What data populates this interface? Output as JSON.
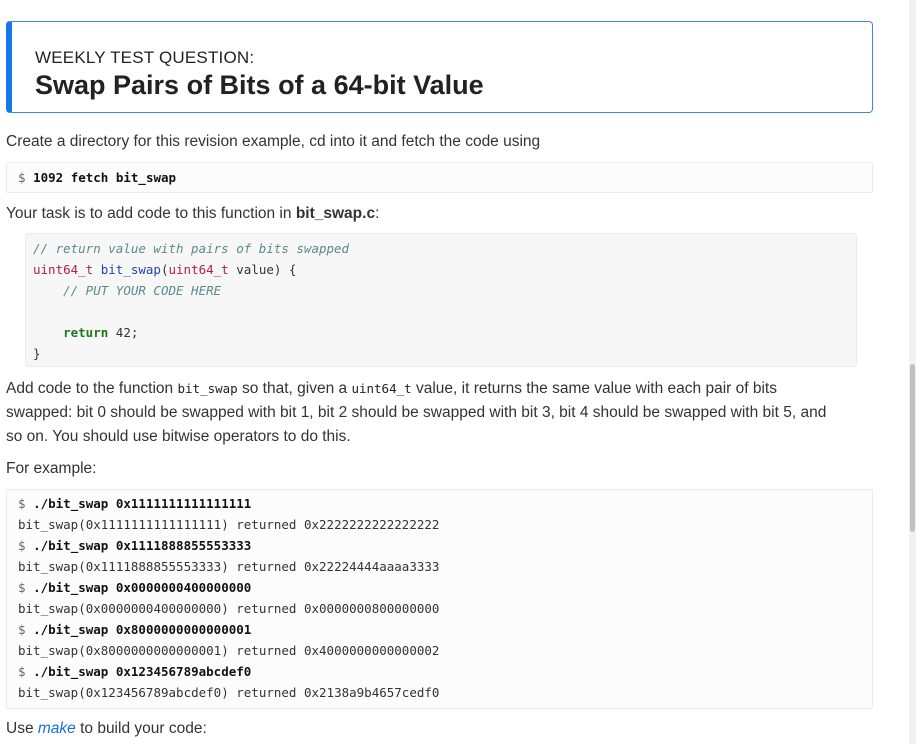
{
  "header": {
    "label": "WEEKLY TEST QUESTION:",
    "title": "Swap Pairs of Bits of a 64-bit Value"
  },
  "intro": {
    "text": "Create a directory for this revision example, cd into it and fetch the code using"
  },
  "fetch_cmd": {
    "prompt": "$ ",
    "command": "1092 fetch bit_swap"
  },
  "task": {
    "prefix": "Your task is to add code to this function in ",
    "file": "bit_swap.c",
    "suffix": ":"
  },
  "code": {
    "comment1": "// return value with pairs of bits swapped",
    "type1": "uint64_t",
    "space1": " ",
    "fn_name": "bit_swap",
    "paren_open": "(",
    "type2": "uint64_t",
    "param": " value) {",
    "indent1": "    ",
    "comment2": "// PUT YOUR CODE HERE",
    "indent2": "    ",
    "kw_return": "return",
    "ret_val": " 42;",
    "close_brace": "}"
  },
  "description": {
    "p1_a": "Add code to the function ",
    "p1_code1": "bit_swap",
    "p1_b": " so that, given a ",
    "p1_code2": "uint64_t",
    "p1_c": " value, it returns the same value with each pair of bits",
    "line2": "swapped: bit 0 should be swapped with bit 1, bit 2 should be swapped with bit 3, bit 4 should be swapped with bit 5, and",
    "line3": "so on. You should use bitwise operators to do this."
  },
  "example": {
    "heading": "For example:",
    "lines": [
      {
        "prompt": "$ ",
        "command": "./bit_swap 0x1111111111111111"
      },
      {
        "output": "bit_swap(0x1111111111111111) returned 0x2222222222222222"
      },
      {
        "prompt": "$ ",
        "command": "./bit_swap 0x1111888855553333"
      },
      {
        "output": "bit_swap(0x1111888855553333) returned 0x22224444aaaa3333"
      },
      {
        "prompt": "$ ",
        "command": "./bit_swap 0x0000000400000000"
      },
      {
        "output": "bit_swap(0x0000000400000000) returned 0x0000000800000000"
      },
      {
        "prompt": "$ ",
        "command": "./bit_swap 0x8000000000000001"
      },
      {
        "output": "bit_swap(0x8000000000000001) returned 0x4000000000000002"
      },
      {
        "prompt": "$ ",
        "command": "./bit_swap 0x123456789abcdef0"
      },
      {
        "output": "bit_swap(0x123456789abcdef0) returned 0x2138a9b4657cedf0"
      }
    ]
  },
  "build": {
    "prefix": "Use ",
    "link": "make",
    "suffix": " to build your code:"
  }
}
